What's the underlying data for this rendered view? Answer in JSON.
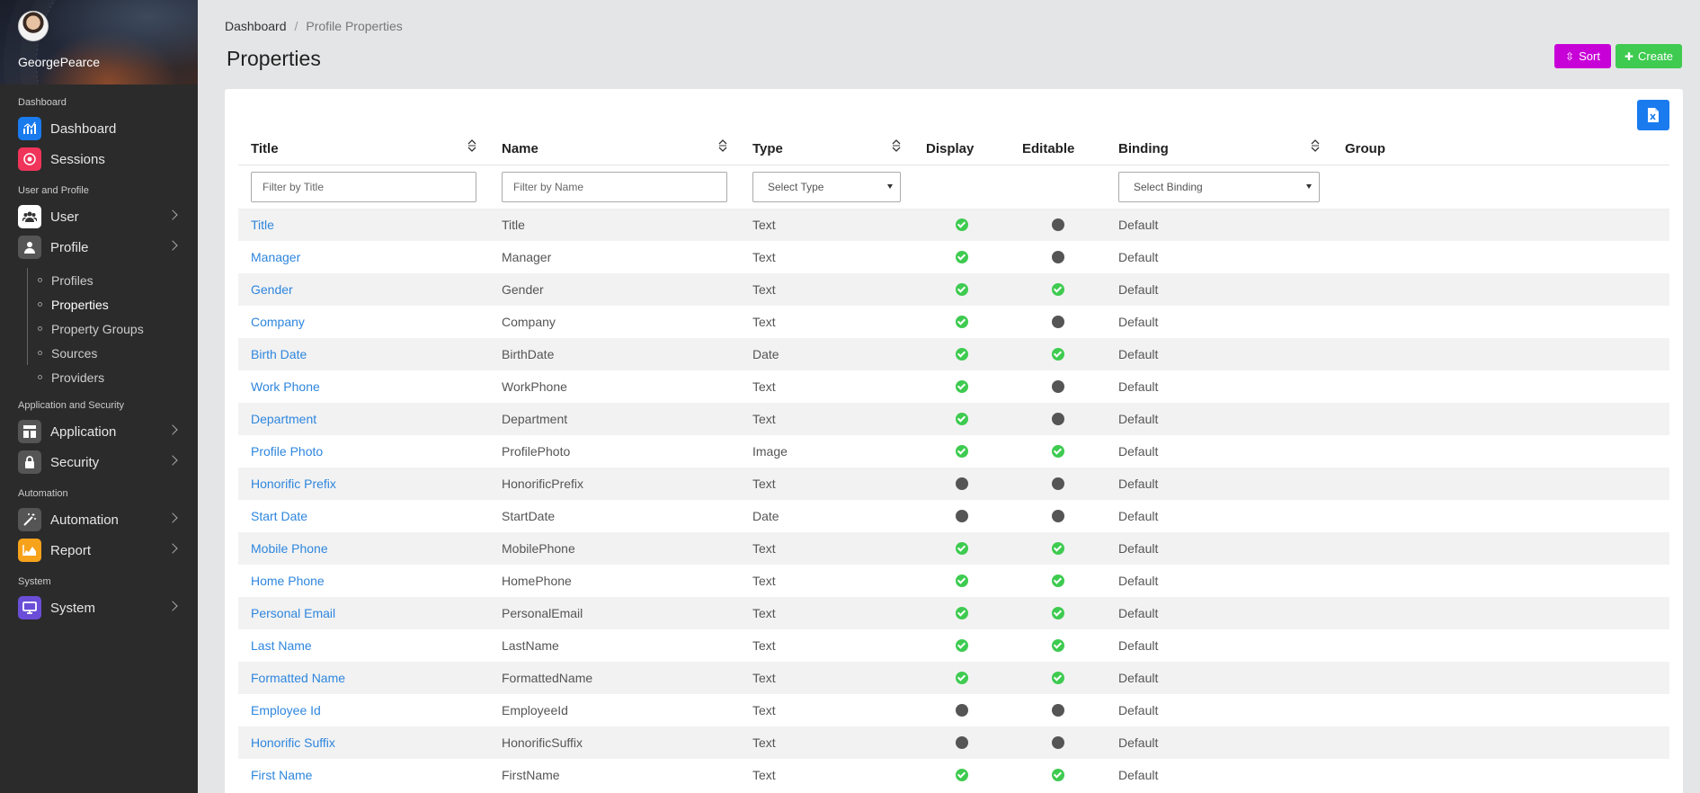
{
  "user": {
    "name": "GeorgePearce"
  },
  "sidebar": {
    "sections": [
      {
        "title": "Dashboard",
        "items": [
          {
            "label": "Dashboard",
            "icon": "chart-icon",
            "color": "#1a7bef",
            "chevron": false
          },
          {
            "label": "Sessions",
            "icon": "record-icon",
            "color": "#f0345a",
            "chevron": false
          }
        ]
      },
      {
        "title": "User and Profile",
        "items": [
          {
            "label": "User",
            "icon": "users-icon",
            "color": "#ffffff",
            "chevron": true
          },
          {
            "label": "Profile",
            "icon": "person-icon",
            "color": "#555555",
            "chevron": true
          }
        ]
      },
      {
        "title": "Application and Security",
        "items": [
          {
            "label": "Application",
            "icon": "app-grid-icon",
            "color": "#555555",
            "chevron": true
          },
          {
            "label": "Security",
            "icon": "lock-icon",
            "color": "#555555",
            "chevron": true
          }
        ]
      },
      {
        "title": "Automation",
        "items": [
          {
            "label": "Automation",
            "icon": "wand-icon",
            "color": "#555555",
            "chevron": true
          },
          {
            "label": "Report",
            "icon": "area-chart-icon",
            "color": "#f7a21b",
            "chevron": true
          }
        ]
      },
      {
        "title": "System",
        "items": [
          {
            "label": "System",
            "icon": "monitor-icon",
            "color": "#6a4ed8",
            "chevron": true
          }
        ]
      }
    ],
    "profile_subitems": [
      "Profiles",
      "Properties",
      "Property Groups",
      "Sources",
      "Providers"
    ],
    "active_subitem": "Properties"
  },
  "breadcrumb": {
    "home": "Dashboard",
    "current": "Profile Properties"
  },
  "page": {
    "title": "Properties"
  },
  "buttons": {
    "sort": "Sort",
    "create": "Create"
  },
  "table": {
    "headers": {
      "title": "Title",
      "name": "Name",
      "type": "Type",
      "display": "Display",
      "editable": "Editable",
      "binding": "Binding",
      "group": "Group"
    },
    "filters": {
      "title_placeholder": "Filter by Title",
      "name_placeholder": "Filter by Name",
      "type_select": "Select Type",
      "binding_select": "Select Binding"
    },
    "rows": [
      {
        "title": "Title",
        "name": "Title",
        "type": "Text",
        "display": true,
        "editable": false,
        "binding": "Default",
        "group": ""
      },
      {
        "title": "Manager",
        "name": "Manager",
        "type": "Text",
        "display": true,
        "editable": false,
        "binding": "Default",
        "group": ""
      },
      {
        "title": "Gender",
        "name": "Gender",
        "type": "Text",
        "display": true,
        "editable": true,
        "binding": "Default",
        "group": ""
      },
      {
        "title": "Company",
        "name": "Company",
        "type": "Text",
        "display": true,
        "editable": false,
        "binding": "Default",
        "group": ""
      },
      {
        "title": "Birth Date",
        "name": "BirthDate",
        "type": "Date",
        "display": true,
        "editable": true,
        "binding": "Default",
        "group": ""
      },
      {
        "title": "Work Phone",
        "name": "WorkPhone",
        "type": "Text",
        "display": true,
        "editable": false,
        "binding": "Default",
        "group": ""
      },
      {
        "title": "Department",
        "name": "Department",
        "type": "Text",
        "display": true,
        "editable": false,
        "binding": "Default",
        "group": ""
      },
      {
        "title": "Profile Photo",
        "name": "ProfilePhoto",
        "type": "Image",
        "display": true,
        "editable": true,
        "binding": "Default",
        "group": ""
      },
      {
        "title": "Honorific Prefix",
        "name": "HonorificPrefix",
        "type": "Text",
        "display": false,
        "editable": false,
        "binding": "Default",
        "group": ""
      },
      {
        "title": "Start Date",
        "name": "StartDate",
        "type": "Date",
        "display": false,
        "editable": false,
        "binding": "Default",
        "group": ""
      },
      {
        "title": "Mobile Phone",
        "name": "MobilePhone",
        "type": "Text",
        "display": true,
        "editable": true,
        "binding": "Default",
        "group": ""
      },
      {
        "title": "Home Phone",
        "name": "HomePhone",
        "type": "Text",
        "display": true,
        "editable": true,
        "binding": "Default",
        "group": ""
      },
      {
        "title": "Personal Email",
        "name": "PersonalEmail",
        "type": "Text",
        "display": true,
        "editable": true,
        "binding": "Default",
        "group": ""
      },
      {
        "title": "Last Name",
        "name": "LastName",
        "type": "Text",
        "display": true,
        "editable": true,
        "binding": "Default",
        "group": ""
      },
      {
        "title": "Formatted Name",
        "name": "FormattedName",
        "type": "Text",
        "display": true,
        "editable": true,
        "binding": "Default",
        "group": ""
      },
      {
        "title": "Employee Id",
        "name": "EmployeeId",
        "type": "Text",
        "display": false,
        "editable": false,
        "binding": "Default",
        "group": ""
      },
      {
        "title": "Honorific Suffix",
        "name": "HonorificSuffix",
        "type": "Text",
        "display": false,
        "editable": false,
        "binding": "Default",
        "group": ""
      },
      {
        "title": "First Name",
        "name": "FirstName",
        "type": "Text",
        "display": true,
        "editable": true,
        "binding": "Default",
        "group": ""
      }
    ]
  }
}
